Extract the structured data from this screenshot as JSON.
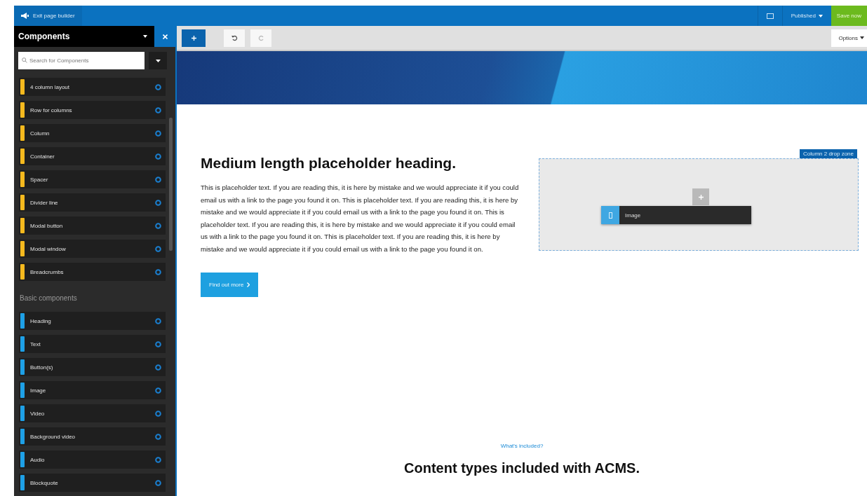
{
  "top_bar": {
    "exit_label": "Exit page builder",
    "status": "Published",
    "save_label": "Save now"
  },
  "sidebar": {
    "title": "Components",
    "search": {
      "placeholder": "Search for Components"
    },
    "groups": [
      {
        "color": "#f5b91e",
        "items": [
          "4 column layout",
          "Row for columns",
          "Column",
          "Container",
          "Spacer",
          "Divider line",
          "Modal button",
          "Modal window",
          "Breadcrumbs"
        ]
      },
      {
        "heading": "Basic components",
        "color": "#1ea0e6",
        "items": [
          "Heading",
          "Text",
          "Button(s)",
          "Image",
          "Video",
          "Background video",
          "Audio",
          "Blockquote"
        ]
      }
    ]
  },
  "toolbar": {
    "options_label": "Options"
  },
  "content": {
    "heading": "Medium length placeholder heading.",
    "paragraph": "This is placeholder text. If you are reading this, it is here by mistake and we would appreciate it if you could email us with a link to the page you found it on. This is placeholder text. If you are reading this, it is here by mistake and we would appreciate it if you could email us with a link to the page you found it on. This is placeholder text. If you are reading this, it is here by mistake and we would appreciate it if you could email us with a link to the page you found it on. This is placeholder text. If you are reading this, it is here by mistake and we would appreciate it if you could email us with a link to the page you found it on.",
    "button_label": "Find out more",
    "drop_zone": {
      "label": "Column 2 drop zone",
      "dragged_item": "Image"
    },
    "section_kicker": "What's included?",
    "section_heading": "Content types included with ACMS."
  }
}
